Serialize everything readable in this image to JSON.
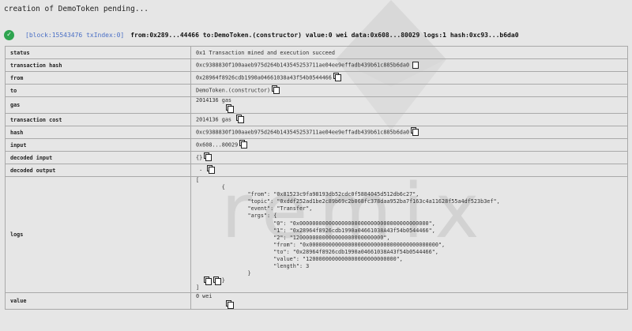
{
  "pending_message": "creation of DemoToken pending...",
  "summary": {
    "block_info": "[block:15543476 txIndex:0]",
    "text": "from:0x289...44466 to:DemoToken.(constructor) value:0 wei data:0x608...80029 logs:1 hash:0xc93...b6da0"
  },
  "watermark_text": "remix",
  "rows": {
    "status": {
      "key": "status",
      "value": "0x1 Transaction mined and execution succeed"
    },
    "transaction_hash": {
      "key": "transaction hash",
      "value": "0xc9388830f100aaeb975d264b143545253711ae04ee9effadb439b61c885b6da0"
    },
    "from": {
      "key": "from",
      "value": "0x28964f8926cdb1990a04661038a43f54b0544466"
    },
    "to": {
      "key": "to",
      "value": "DemoToken.(constructor)"
    },
    "gas": {
      "key": "gas",
      "value": "2014136 gas"
    },
    "transaction_cost": {
      "key": "transaction cost",
      "value": "2014136 gas"
    },
    "hash": {
      "key": "hash",
      "value": "0xc9388830f100aaeb975d264b143545253711ae04ee9effadb439b61c885b6da0"
    },
    "input": {
      "key": "input",
      "value": "0x608...80029"
    },
    "decoded_input": {
      "key": "decoded input",
      "value": "{}"
    },
    "decoded_output": {
      "key": "decoded output",
      "value": "-"
    },
    "logs": {
      "key": "logs"
    },
    "value": {
      "key": "value",
      "value": "0 wei"
    }
  },
  "logs_text": "[\n\t{\n\t\t\"from\": \"0x81523c9fa98193db52cdc0f5884045d512db6c27\",\n\t\t\"topic\": \"0xddf252ad1be2c89b69c2b068fc378daa952ba7f163c4a11628f55a4df523b3ef\",\n\t\t\"event\": \"Transfer\",\n\t\t\"args\": {\n\t\t\t\"0\": \"0x0000000000000000000000000000000000000000\",\n\t\t\t\"1\": \"0x28964f8926cdb1990a04661038A43f54b0544466\",\n\t\t\t\"2\": \"1200000000000000000000000000\",\n\t\t\t\"from\": \"0x0000000000000000000000000000000000000000\",\n\t\t\t\"to\": \"0x28964f8926cdb1990a04661038A43f54b0544466\",\n\t\t\t\"value\": \"1200000000000000000000000000\",\n\t\t\t\"length\": 3\n\t\t}\n\t}\n]"
}
